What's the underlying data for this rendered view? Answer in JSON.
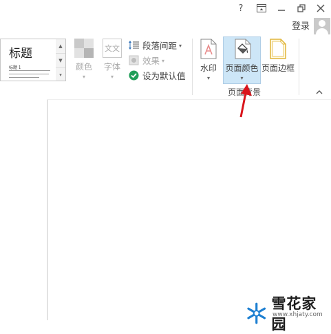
{
  "titlebar": {
    "help": "?",
    "ribbon_display": "⊡",
    "minimize": "—",
    "restore": "❐",
    "close": "✕"
  },
  "account": {
    "login_label": "登录"
  },
  "ribbon": {
    "styles_gallery": {
      "heading": "标题",
      "heading1": "标题 1",
      "scroll_up": "▲",
      "scroll_down": "▼",
      "more": "▾"
    },
    "colors_label": "颜色",
    "fonts_label": "字体",
    "fonts_icon_text": "文文",
    "paragraph_spacing_label": "段落间距",
    "effects_label": "效果",
    "set_default_label": "设为默认值",
    "watermark_label": "水印",
    "page_color_label": "页面颜色",
    "page_borders_label": "页面边框",
    "page_background_group_label": "页面背景",
    "caret": "▾",
    "collapse": "^"
  },
  "watermark_brand": {
    "name": "雪花家园",
    "url": "www.xhjaty.com"
  },
  "colors": {
    "accent_red": "#d9141b",
    "highlight": "#cde6f7",
    "brand_blue": "#1d7fd1"
  }
}
